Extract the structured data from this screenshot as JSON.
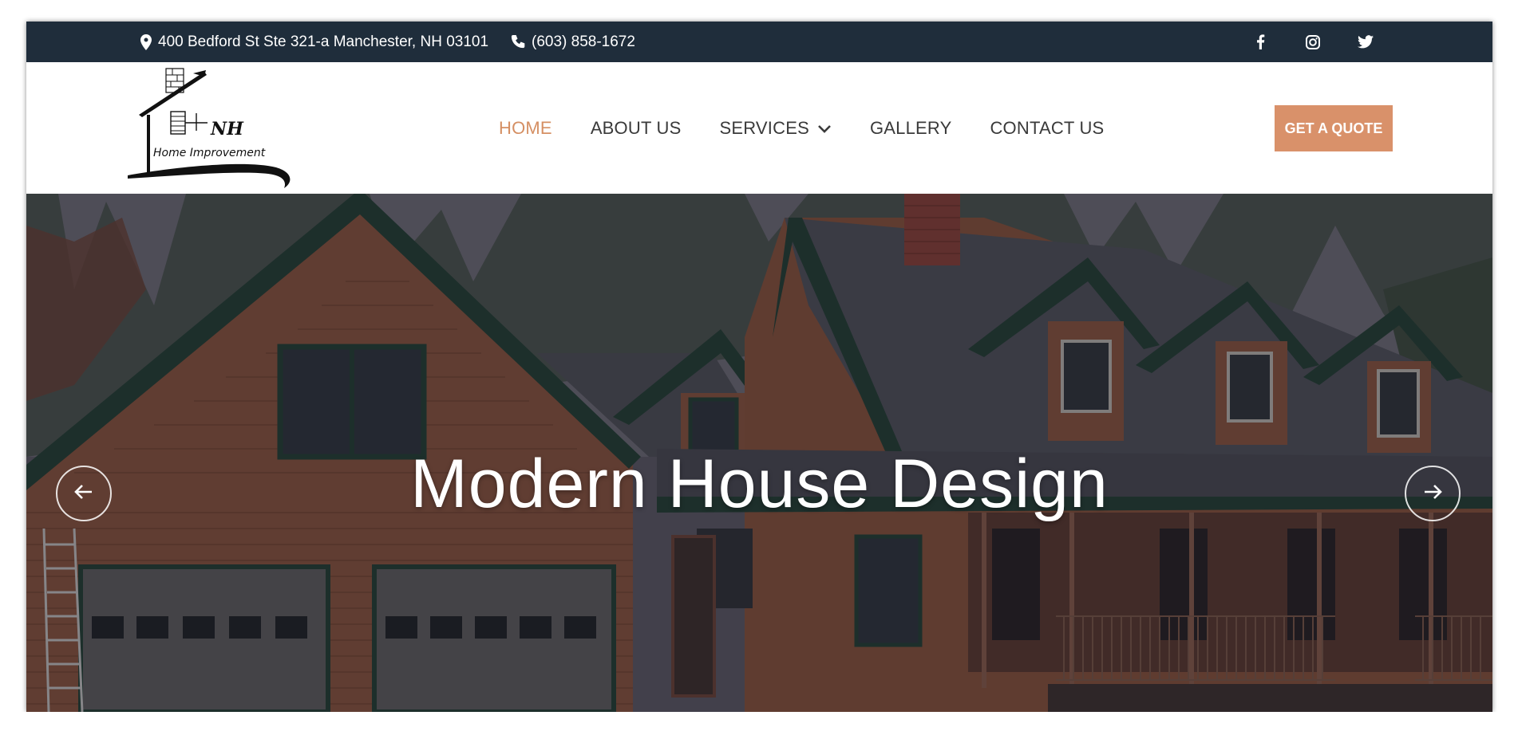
{
  "topbar": {
    "address": "400 Bedford St Ste 321-a Manchester, NH 03101",
    "phone": "(603) 858-1672",
    "social": [
      "facebook-icon",
      "instagram-icon",
      "twitter-icon"
    ]
  },
  "logo": {
    "line1": "NH",
    "line2": "Home Improvement"
  },
  "nav": {
    "items": [
      {
        "label": "HOME",
        "active": true
      },
      {
        "label": "ABOUT US"
      },
      {
        "label": "SERVICES"
      },
      {
        "label": "GALLERY"
      },
      {
        "label": "CONTACT US"
      }
    ]
  },
  "cta": {
    "label": "GET A QUOTE"
  },
  "hero": {
    "title": "Modern House Design"
  },
  "colors": {
    "topbar_bg": "#1f2d3b",
    "accent": "#d58f63",
    "button_bg": "#d9916a",
    "nav_text": "#3a3a3a"
  }
}
